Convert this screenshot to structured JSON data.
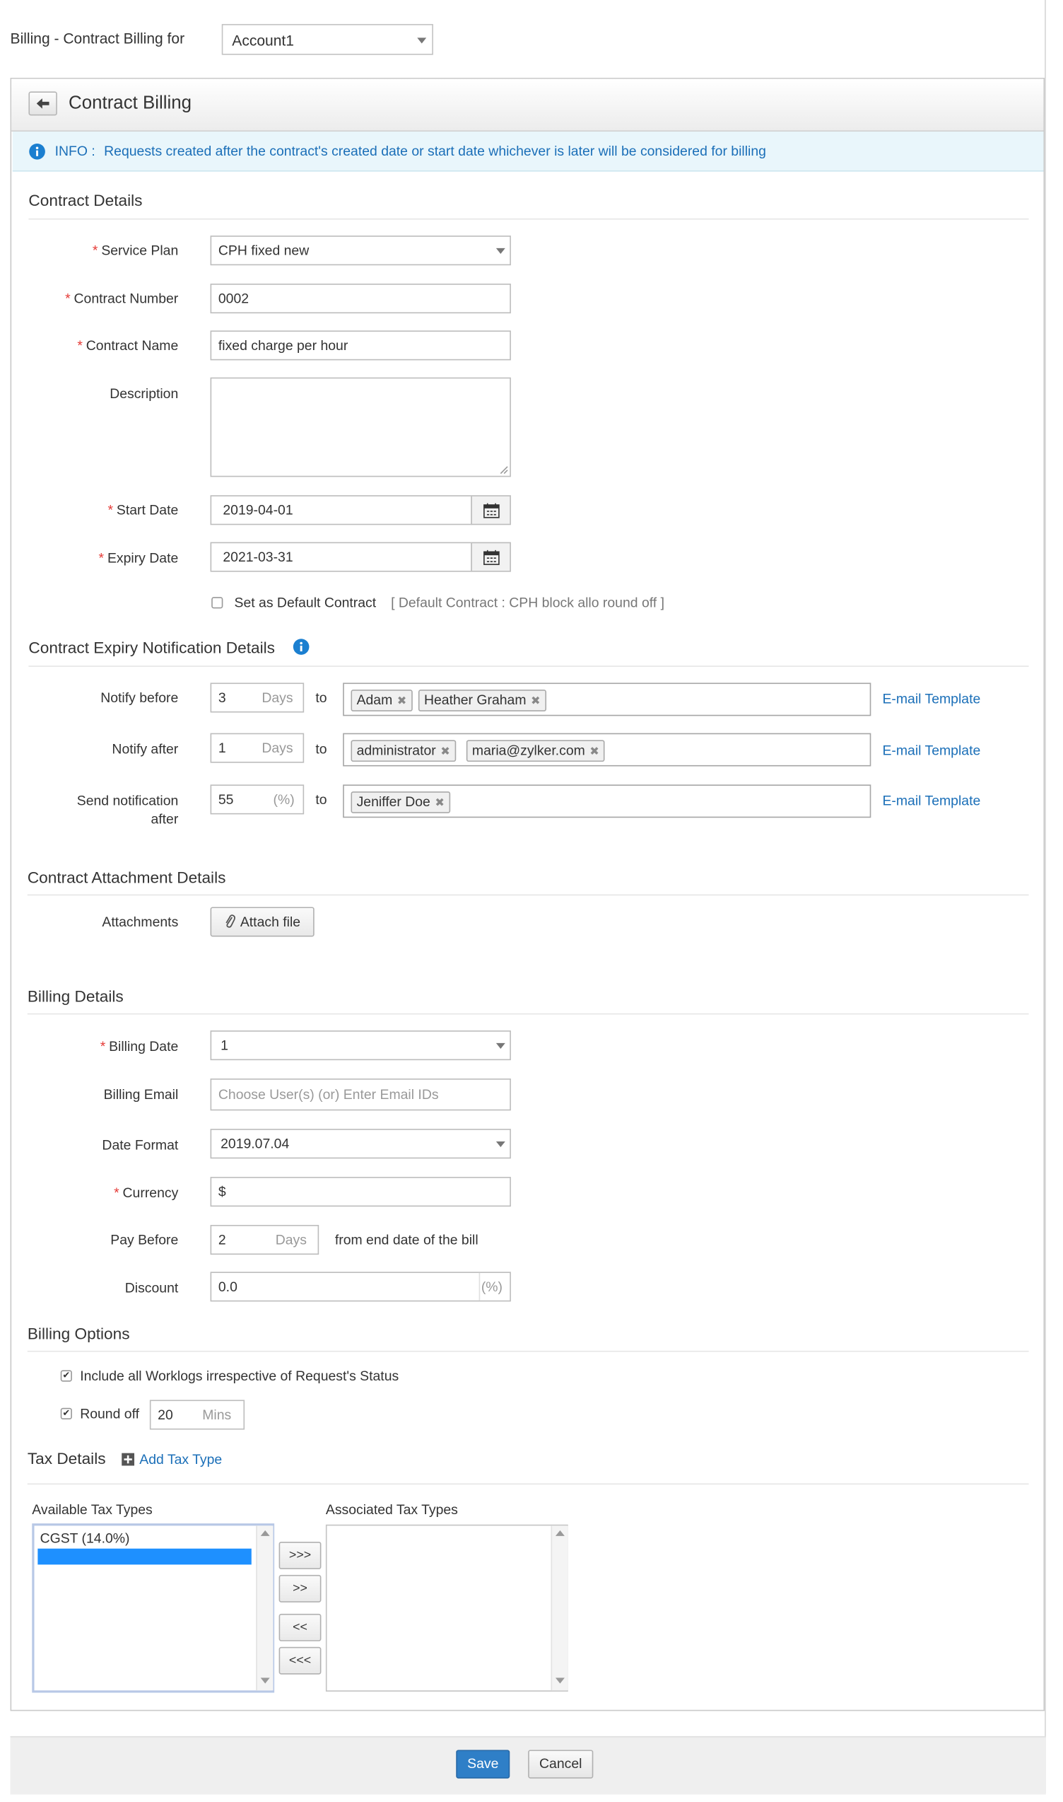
{
  "top": {
    "title": "Billing - Contract Billing for",
    "account": "Account1"
  },
  "header": {
    "title": "Contract Billing"
  },
  "info": {
    "prefix": "INFO :",
    "text": "Requests created after the contract's created date or start date whichever is later will be considered for billing"
  },
  "contract_details": {
    "heading": "Contract Details",
    "service_plan_label": "Service Plan",
    "service_plan": "CPH fixed new",
    "contract_number_label": "Contract Number",
    "contract_number": "0002",
    "contract_name_label": "Contract Name",
    "contract_name": "fixed charge per hour",
    "description_label": "Description",
    "start_date_label": "Start Date",
    "start_date": "2019-04-01",
    "expiry_date_label": "Expiry Date",
    "expiry_date": "2021-03-31",
    "default_label": "Set as Default Contract",
    "default_note": "[ Default Contract : CPH block allo round off ]"
  },
  "notification": {
    "heading": "Contract Expiry Notification Details",
    "to": "to",
    "email_template": "E-mail Template",
    "rows": [
      {
        "label": "Notify before",
        "value": "3",
        "unit": "Days",
        "recipients": [
          "Adam",
          "Heather Graham"
        ]
      },
      {
        "label": "Notify after",
        "value": "1",
        "unit": "Days",
        "recipients": [
          "administrator",
          "maria@zylker.com"
        ]
      },
      {
        "label_line1": "Send notification",
        "label_line2": "after",
        "value": "55",
        "unit": "(%)",
        "recipients": [
          "Jeniffer Doe"
        ]
      }
    ]
  },
  "attachments": {
    "heading": "Contract Attachment Details",
    "label": "Attachments",
    "button": "Attach file"
  },
  "billing": {
    "heading": "Billing Details",
    "billing_date_label": "Billing Date",
    "billing_date": "1",
    "billing_email_label": "Billing Email",
    "billing_email_placeholder": "Choose User(s) (or) Enter Email IDs",
    "date_format_label": "Date Format",
    "date_format": "2019.07.04",
    "currency_label": "Currency",
    "currency": "$",
    "pay_before_label": "Pay Before",
    "pay_before": "2",
    "pay_before_unit": "Days",
    "pay_before_suffix": "from end date of the bill",
    "discount_label": "Discount",
    "discount": "0.0",
    "discount_unit": "(%)"
  },
  "billing_options": {
    "heading": "Billing Options",
    "include_worklogs": "Include all Worklogs irrespective of Request's Status",
    "round_off": "Round off",
    "round_off_value": "20",
    "round_off_unit": "Mins"
  },
  "tax": {
    "heading": "Tax Details",
    "add_link": "Add Tax Type",
    "available_label": "Available Tax Types",
    "associated_label": "Associated Tax Types",
    "available": [
      "CGST (14.0%)"
    ],
    "buttons": [
      ">>>",
      ">>",
      "<<",
      "<<<"
    ]
  },
  "footer": {
    "save": "Save",
    "cancel": "Cancel"
  },
  "colors": {
    "accent": "#1b6fb8",
    "save_button": "#2f7fc7",
    "info_bg": "#e9f6fb",
    "selection": "#1e90ff"
  }
}
